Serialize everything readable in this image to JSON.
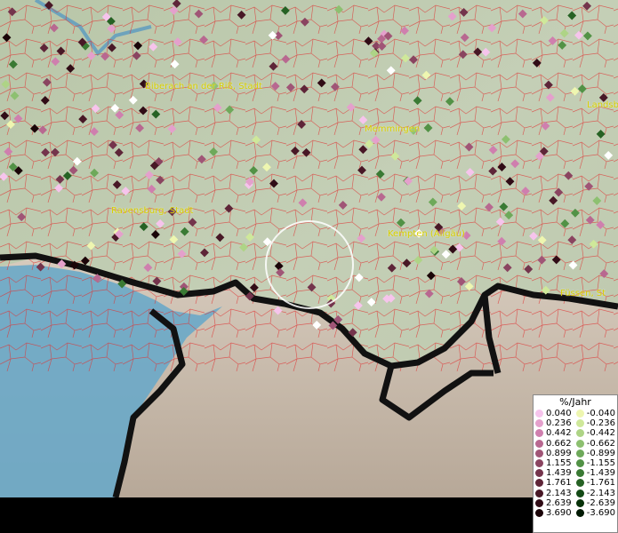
{
  "map": {
    "labels": [
      {
        "id": "biberach",
        "text": "Biberach an der Riß, Stadt"
      },
      {
        "id": "memmingen",
        "text": "Memmingen"
      },
      {
        "id": "landsberg",
        "text": "Landsb"
      },
      {
        "id": "ravensburg",
        "text": "Ravensburg, Stadt"
      },
      {
        "id": "kempten",
        "text": "Kempten (Allgäu)"
      },
      {
        "id": "fuessen",
        "text": "Füssen, St"
      }
    ],
    "selection": "focus-circle"
  },
  "legend": {
    "title": "%/Jahr",
    "positive": [
      {
        "value": "0.040",
        "color": "#f6c4ec"
      },
      {
        "value": "0.236",
        "color": "#e4a0cc"
      },
      {
        "value": "0.442",
        "color": "#cf7fae"
      },
      {
        "value": "0.662",
        "color": "#b86890"
      },
      {
        "value": "0.899",
        "color": "#a05576"
      },
      {
        "value": "1.155",
        "color": "#8a4460"
      },
      {
        "value": "1.439",
        "color": "#74344c"
      },
      {
        "value": "1.761",
        "color": "#5e2538"
      },
      {
        "value": "2.143",
        "color": "#481826"
      },
      {
        "value": "2.639",
        "color": "#300c16"
      },
      {
        "value": "3.690",
        "color": "#1a0408"
      }
    ],
    "negative": [
      {
        "value": "-0.040",
        "color": "#eef6b0"
      },
      {
        "value": "-0.236",
        "color": "#cfe89a"
      },
      {
        "value": "-0.442",
        "color": "#aed486"
      },
      {
        "value": "-0.662",
        "color": "#8dc070"
      },
      {
        "value": "-0.899",
        "color": "#6ea95a"
      },
      {
        "value": "-1.155",
        "color": "#529246"
      },
      {
        "value": "-1.439",
        "color": "#3a7a34"
      },
      {
        "value": "-1.761",
        "color": "#266224"
      },
      {
        "value": "-2.143",
        "color": "#144a16"
      },
      {
        "value": "-2.639",
        "color": "#08320a"
      },
      {
        "value": "-3.690",
        "color": "#021a04"
      }
    ]
  }
}
